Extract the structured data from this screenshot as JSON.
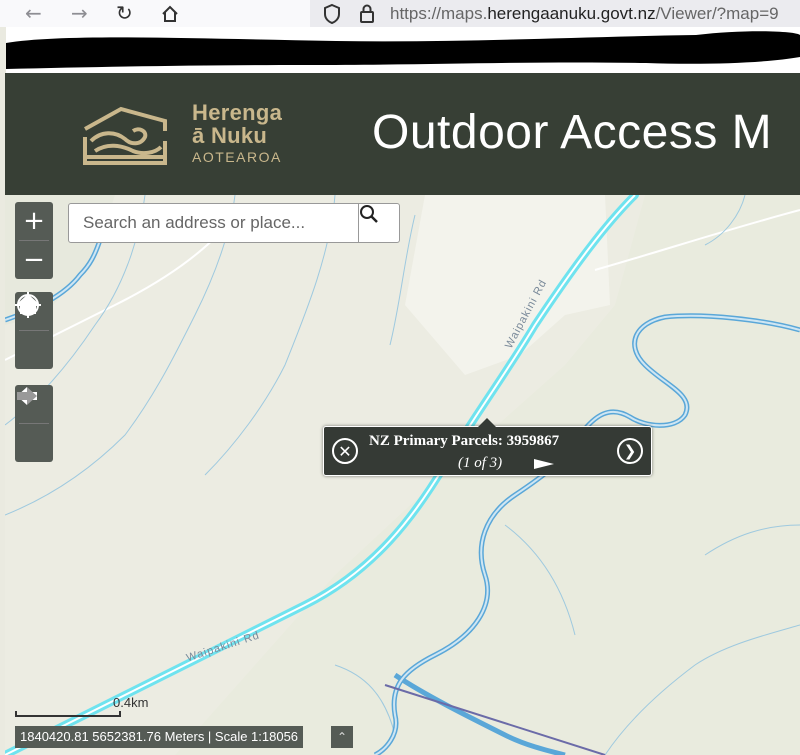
{
  "browser": {
    "url_prefix": "https://maps.",
    "url_host": "herengaanuku.govt.nz",
    "url_path": "/Viewer/?map=9"
  },
  "header": {
    "logo_line1": "Herenga",
    "logo_line2": "ā Nuku",
    "logo_line3": "AOTEAROA",
    "title": "Outdoor Access M"
  },
  "search": {
    "placeholder": "Search an address or place..."
  },
  "controls": {
    "zoom_in": "+",
    "zoom_out": "−"
  },
  "popup": {
    "title": "NZ Primary Parcels: 3959867",
    "count": "(1 of 3)"
  },
  "map": {
    "road_label_upper": "Waipakini Rd",
    "road_label_lower": "Waipakini Rd"
  },
  "scale": {
    "label": "0.4km"
  },
  "status": {
    "coordinates": "1840420.81 5652381.76 Meters | Scale 1:18056"
  },
  "colors": {
    "header_bg": "#373f35",
    "logo_gold": "#c9b78c",
    "road_cyan": "#6fe3ef",
    "river_blue": "#5aa7d8",
    "control_bg": "#555b55"
  }
}
